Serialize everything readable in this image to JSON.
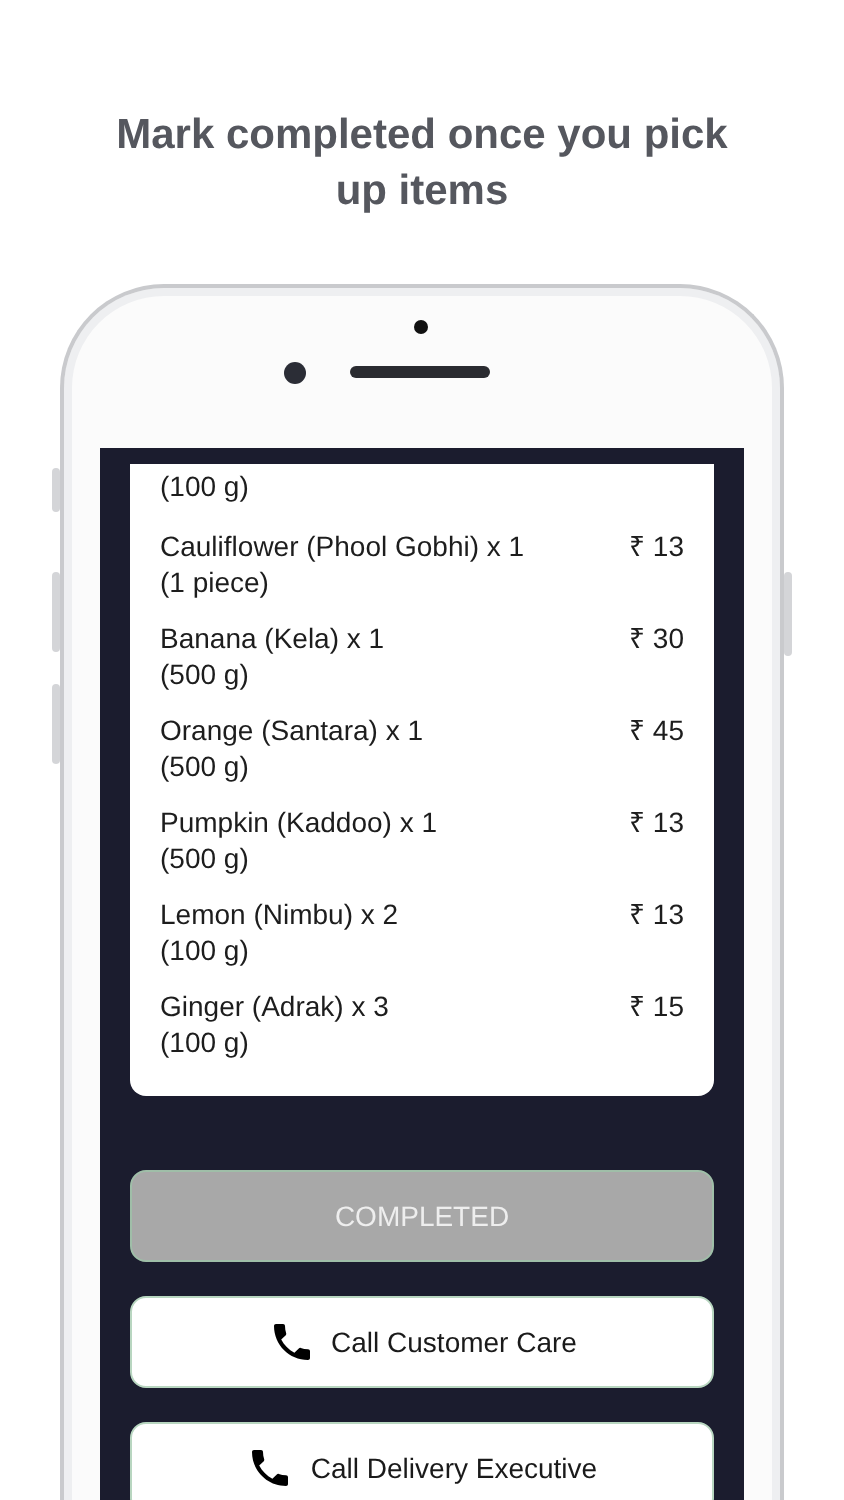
{
  "headline": "Mark completed once you pick up items",
  "items": [
    {
      "unit": "(100 g)"
    },
    {
      "name": "Cauliflower (Phool Gobhi) x 1",
      "unit": "(1 piece)",
      "price": "₹ 13"
    },
    {
      "name": "Banana (Kela) x 1",
      "unit": "(500 g)",
      "price": "₹ 30"
    },
    {
      "name": "Orange (Santara) x 1",
      "unit": "(500 g)",
      "price": "₹ 45"
    },
    {
      "name": "Pumpkin (Kaddoo) x 1",
      "unit": "(500 g)",
      "price": "₹ 13"
    },
    {
      "name": "Lemon (Nimbu) x 2",
      "unit": "(100 g)",
      "price": "₹ 13"
    },
    {
      "name": "Ginger (Adrak) x 3",
      "unit": "(100 g)",
      "price": "₹ 15"
    }
  ],
  "completed_button": {
    "label": "COMPLETED",
    "disabled": true
  },
  "call_buttons": [
    {
      "label": "Call Customer Care"
    },
    {
      "label": "Call Delivery Executive"
    }
  ]
}
